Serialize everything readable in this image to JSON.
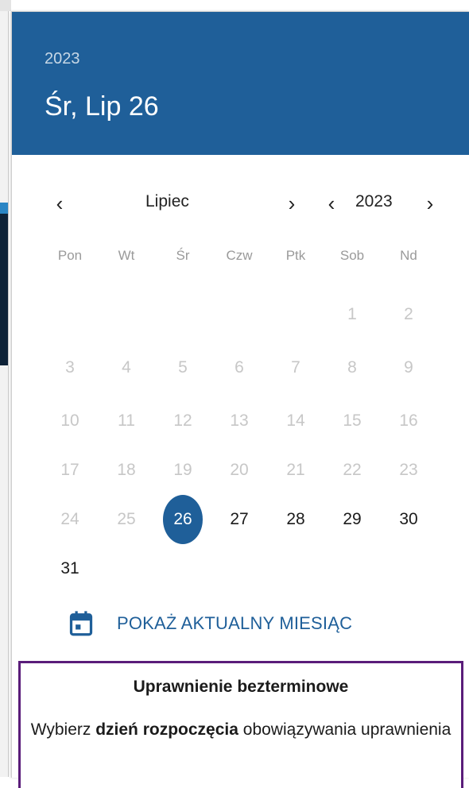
{
  "header": {
    "year": "2023",
    "selected_date": "Śr, Lip 26"
  },
  "navigation": {
    "prev_month_icon": "chevron-left-icon",
    "month": "Lipiec",
    "next_month_icon": "chevron-right-icon",
    "prev_year_icon": "chevron-left-icon",
    "year": "2023",
    "next_year_icon": "chevron-right-icon",
    "prev_symbol": "‹",
    "next_symbol": "›"
  },
  "weekdays": [
    "Pon",
    "Wt",
    "Śr",
    "Czw",
    "Ptk",
    "Sob",
    "Nd"
  ],
  "weeks": [
    [
      null,
      null,
      null,
      null,
      null,
      "1",
      "2"
    ],
    [
      "3",
      "4",
      "5",
      "6",
      "7",
      "8",
      "9"
    ],
    [
      "10",
      "11",
      "12",
      "13",
      "14",
      "15",
      "16"
    ],
    [
      "17",
      "18",
      "19",
      "20",
      "21",
      "22",
      "23"
    ],
    [
      "24",
      "25",
      "26",
      "27",
      "28",
      "29",
      "30"
    ],
    [
      "31",
      null,
      null,
      null,
      null,
      null,
      null
    ]
  ],
  "selected_day": "26",
  "enabled_days": [
    "26",
    "27",
    "28",
    "29",
    "30",
    "31"
  ],
  "today_button": {
    "icon": "calendar-icon",
    "label": "POKAŻ AKTUALNY MIESIĄC"
  },
  "info": {
    "title": "Uprawnienie bezterminowe",
    "body_before": "Wybierz ",
    "body_bold": "dzień rozpoczęcia",
    "body_after": " obowiązywania uprawnienia"
  },
  "colors": {
    "primary": "#1f5f99",
    "info_border": "#5a1d7a",
    "disabled_text": "#c7c7c7"
  }
}
